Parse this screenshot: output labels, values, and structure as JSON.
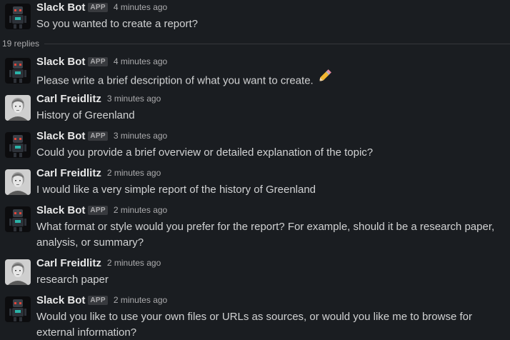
{
  "parent": {
    "name": "Slack Bot",
    "badge": "APP",
    "time": "4 minutes ago",
    "text": "So you wanted to create a report?"
  },
  "replies_label": "19 replies",
  "messages": [
    {
      "name": "Slack Bot",
      "badge": "APP",
      "time": "4 minutes ago",
      "text": "Please write a brief description of what you want to create."
    },
    {
      "name": "Carl Freidlitz",
      "time": "3 minutes ago",
      "text": "History of Greenland"
    },
    {
      "name": "Slack Bot",
      "badge": "APP",
      "time": "3 minutes ago",
      "text": "Could you provide a brief overview or detailed explanation of the topic?"
    },
    {
      "name": "Carl Freidlitz",
      "time": "2 minutes ago",
      "text": "I would like a very simple report of the history of Greenland"
    },
    {
      "name": "Slack Bot",
      "badge": "APP",
      "time": "2 minutes ago",
      "text": "What format or style would you prefer for the report? For example, should it be a research paper, analysis, or summary?"
    },
    {
      "name": "Carl Freidlitz",
      "time": "2 minutes ago",
      "text": "research paper"
    },
    {
      "name": "Slack Bot",
      "badge": "APP",
      "time": "2 minutes ago",
      "text": "Would you like to use your own files or URLs as sources, or would you like me to browse for external information?"
    }
  ],
  "icons": {
    "bot_avatar": "robot-avatar-icon",
    "user_avatar": "user-photo-avatar",
    "emoji": "pencil-icon"
  }
}
